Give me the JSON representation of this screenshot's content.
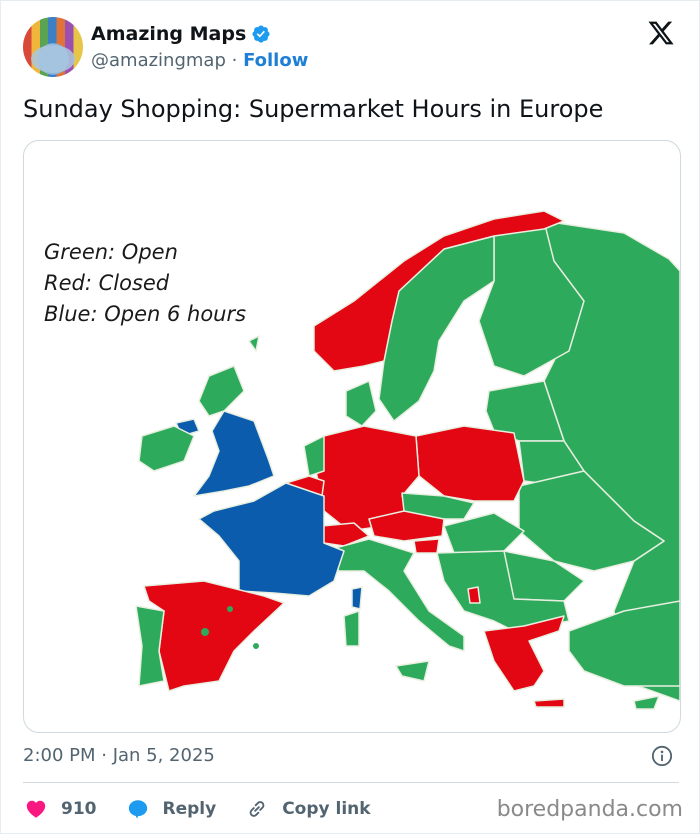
{
  "tweet": {
    "author": {
      "display_name": "Amazing Maps",
      "handle": "@amazingmap",
      "verified": true,
      "follow_label": "Follow",
      "separator": "·"
    },
    "platform_icon": "x-logo-icon",
    "text": "Sunday Shopping: Supermarket Hours in Europe",
    "timestamp": "2:00 PM · Jan 5, 2025",
    "likes": "910",
    "reply_label": "Reply",
    "copy_link_label": "Copy link"
  },
  "map": {
    "legend": [
      "Green: Open",
      "Red: Closed",
      "Blue: Open 6 hours"
    ],
    "colors": {
      "open": "#2eaa5c",
      "closed": "#e30613",
      "open_6_hours": "#0b5cad",
      "border": "#e8efe0"
    },
    "countries": {
      "closed": [
        "Norway",
        "Germany",
        "Poland",
        "Austria",
        "Switzerland",
        "Belgium",
        "Slovenia",
        "Spain",
        "Greece",
        "Montenegro"
      ],
      "open_6_hours": [
        "France",
        "United Kingdom",
        "Northern Ireland",
        "Corsica"
      ],
      "open": [
        "Sweden",
        "Finland",
        "Russia",
        "Estonia",
        "Latvia",
        "Lithuania",
        "Belarus",
        "Ukraine",
        "Denmark",
        "Netherlands",
        "Ireland",
        "Scotland",
        "Portugal",
        "Italy",
        "Czechia",
        "Slovakia",
        "Hungary",
        "Romania",
        "Bulgaria",
        "Croatia",
        "Serbia",
        "Bosnia",
        "Albania",
        "North Macedonia",
        "Kosovo",
        "Moldova",
        "Turkey",
        "Cyprus",
        "Sardinia"
      ]
    }
  },
  "watermark": "boredpanda.com",
  "colors": {
    "accent": "#1d7fd6",
    "like": "#f91880",
    "reply": "#1d9bf0",
    "muted": "#536471"
  }
}
